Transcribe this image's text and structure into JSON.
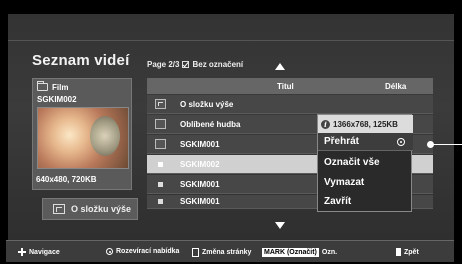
{
  "header": {
    "title": "Seznam videí",
    "page": "Page 2/3",
    "filter_label": "Bez označení"
  },
  "preview": {
    "type_label": "Film",
    "file_name": "SGKIM002",
    "resolution": "640x480, 720KB",
    "up_button_label": "O složku výše"
  },
  "list": {
    "col_title": "Titul",
    "col_length": "Délka",
    "rows": [
      {
        "label": "O složku výše",
        "icon": "folder-up-icon"
      },
      {
        "label": "Oblíbené hudba",
        "icon": "folder-icon"
      },
      {
        "label": "SGKIM001",
        "icon": "folder-icon"
      },
      {
        "label": "SGKIM002",
        "icon": "video-file-icon",
        "selected": true
      },
      {
        "label": "SGKIM001",
        "icon": "video-file-icon"
      },
      {
        "label": "SGKIM001",
        "icon": "video-file-icon"
      }
    ]
  },
  "context_menu": {
    "info": "1366x768, 125KB",
    "items": [
      "Přehrát",
      "Označit vše",
      "Vymazat",
      "Zavřít"
    ]
  },
  "footer": {
    "navigation": "Navigace",
    "dropdown": "Rozevírací nabídka",
    "page_change": "Změna stránky",
    "mark_key": "MARK (Označit)",
    "mark_label": "Ozn.",
    "back": "Zpět"
  }
}
